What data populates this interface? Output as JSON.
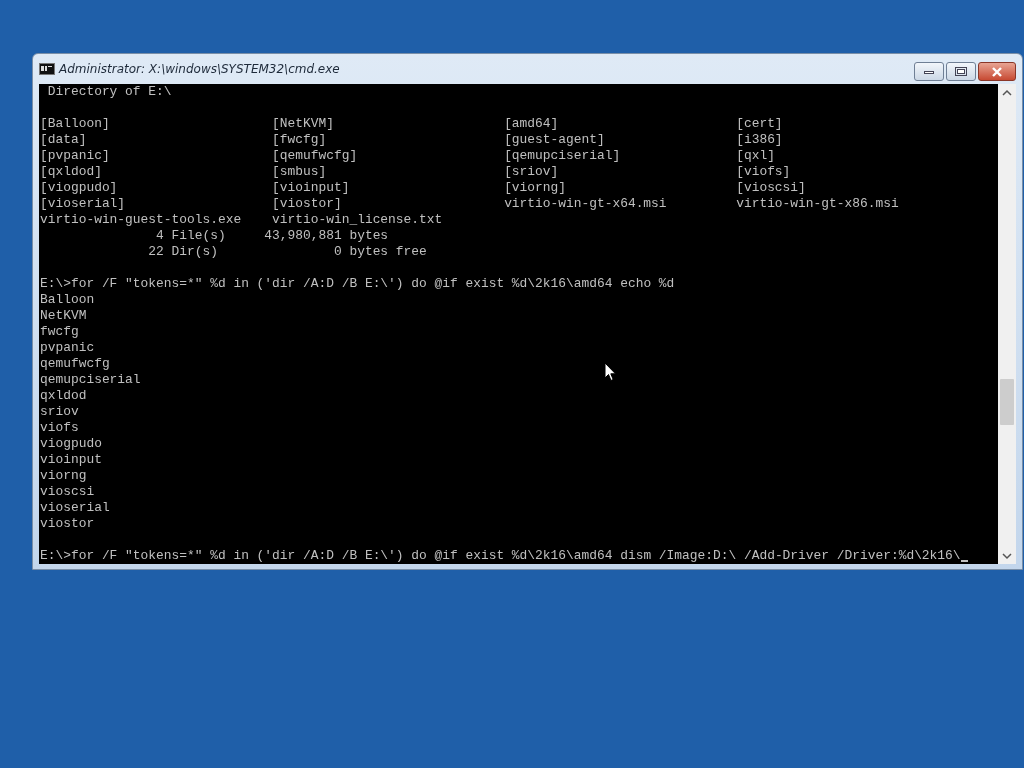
{
  "window": {
    "title": "Administrator: X:\\windows\\SYSTEM32\\cmd.exe"
  },
  "console": {
    "lines": [
      {
        "kind": "text",
        "text": " Directory of E:\\"
      },
      {
        "kind": "blank"
      },
      {
        "kind": "columns",
        "cells": [
          "[Balloon]",
          "[NetKVM]",
          "[amd64]",
          "[cert]"
        ]
      },
      {
        "kind": "columns",
        "cells": [
          "[data]",
          "[fwcfg]",
          "[guest-agent]",
          "[i386]"
        ]
      },
      {
        "kind": "columns",
        "cells": [
          "[pvpanic]",
          "[qemufwcfg]",
          "[qemupciserial]",
          "[qxl]"
        ]
      },
      {
        "kind": "columns",
        "cells": [
          "[qxldod]",
          "[smbus]",
          "[sriov]",
          "[viofs]"
        ]
      },
      {
        "kind": "columns",
        "cells": [
          "[viogpudo]",
          "[vioinput]",
          "[viorng]",
          "[vioscsi]"
        ]
      },
      {
        "kind": "columns",
        "cells": [
          "[vioserial]",
          "[viostor]",
          "virtio-win-gt-x64.msi",
          "virtio-win-gt-x86.msi"
        ]
      },
      {
        "kind": "columns",
        "cells": [
          "virtio-win-guest-tools.exe",
          "virtio-win_license.txt"
        ]
      },
      {
        "kind": "text",
        "text": "               4 File(s)     43,980,881 bytes"
      },
      {
        "kind": "text",
        "text": "              22 Dir(s)               0 bytes free"
      },
      {
        "kind": "blank"
      },
      {
        "kind": "text",
        "text": "E:\\>for /F \"tokens=*\" %d in ('dir /A:D /B E:\\') do @if exist %d\\2k16\\amd64 echo %d"
      },
      {
        "kind": "text",
        "text": "Balloon"
      },
      {
        "kind": "text",
        "text": "NetKVM"
      },
      {
        "kind": "text",
        "text": "fwcfg"
      },
      {
        "kind": "text",
        "text": "pvpanic"
      },
      {
        "kind": "text",
        "text": "qemufwcfg"
      },
      {
        "kind": "text",
        "text": "qemupciserial"
      },
      {
        "kind": "text",
        "text": "qxldod"
      },
      {
        "kind": "text",
        "text": "sriov"
      },
      {
        "kind": "text",
        "text": "viofs"
      },
      {
        "kind": "text",
        "text": "viogpudo"
      },
      {
        "kind": "text",
        "text": "vioinput"
      },
      {
        "kind": "text",
        "text": "viorng"
      },
      {
        "kind": "text",
        "text": "vioscsi"
      },
      {
        "kind": "text",
        "text": "vioserial"
      },
      {
        "kind": "text",
        "text": "viostor"
      },
      {
        "kind": "blank"
      },
      {
        "kind": "prompt",
        "text": "E:\\>for /F \"tokens=*\" %d in ('dir /A:D /B E:\\') do @if exist %d\\2k16\\amd64 dism /Image:D:\\ /Add-Driver /Driver:%d\\2k16\\"
      }
    ]
  }
}
